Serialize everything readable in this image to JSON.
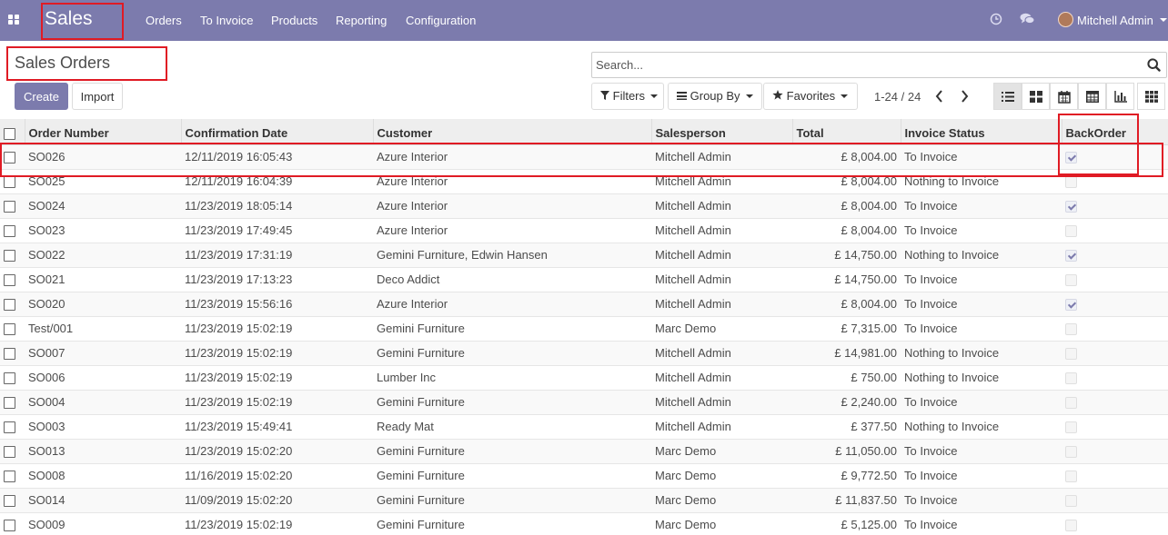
{
  "navbar": {
    "app_name": "Sales",
    "menu": [
      "Orders",
      "To Invoice",
      "Products",
      "Reporting",
      "Configuration"
    ],
    "user_name": "Mitchell Admin",
    "icons": [
      "apps-icon",
      "clock-icon",
      "chat-icon",
      "avatar"
    ]
  },
  "control_panel": {
    "title": "Sales Orders",
    "create_label": "Create",
    "import_label": "Import",
    "search_placeholder": "Search...",
    "filters_label": "Filters",
    "groupby_label": "Group By",
    "favorites_label": "Favorites",
    "pager": "1-24 / 24",
    "views": [
      "list",
      "kanban",
      "calendar",
      "pivot",
      "graph",
      "grid"
    ],
    "active_view": "list"
  },
  "table": {
    "columns": [
      "Order Number",
      "Confirmation Date",
      "Customer",
      "Salesperson",
      "Total",
      "Invoice Status",
      "BackOrder"
    ],
    "rows": [
      {
        "order": "SO026",
        "date": "12/11/2019 16:05:43",
        "customer": "Azure Interior",
        "salesperson": "Mitchell Admin",
        "total": "£ 8,004.00",
        "status": "To Invoice",
        "backorder": true
      },
      {
        "order": "SO025",
        "date": "12/11/2019 16:04:39",
        "customer": "Azure Interior",
        "salesperson": "Mitchell Admin",
        "total": "£ 8,004.00",
        "status": "Nothing to Invoice",
        "backorder": false
      },
      {
        "order": "SO024",
        "date": "11/23/2019 18:05:14",
        "customer": "Azure Interior",
        "salesperson": "Mitchell Admin",
        "total": "£ 8,004.00",
        "status": "To Invoice",
        "backorder": true
      },
      {
        "order": "SO023",
        "date": "11/23/2019 17:49:45",
        "customer": "Azure Interior",
        "salesperson": "Mitchell Admin",
        "total": "£ 8,004.00",
        "status": "To Invoice",
        "backorder": false
      },
      {
        "order": "SO022",
        "date": "11/23/2019 17:31:19",
        "customer": "Gemini Furniture, Edwin Hansen",
        "salesperson": "Mitchell Admin",
        "total": "£ 14,750.00",
        "status": "Nothing to Invoice",
        "backorder": true
      },
      {
        "order": "SO021",
        "date": "11/23/2019 17:13:23",
        "customer": "Deco Addict",
        "salesperson": "Mitchell Admin",
        "total": "£ 14,750.00",
        "status": "To Invoice",
        "backorder": false
      },
      {
        "order": "SO020",
        "date": "11/23/2019 15:56:16",
        "customer": "Azure Interior",
        "salesperson": "Mitchell Admin",
        "total": "£ 8,004.00",
        "status": "To Invoice",
        "backorder": true
      },
      {
        "order": "Test/001",
        "date": "11/23/2019 15:02:19",
        "customer": "Gemini Furniture",
        "salesperson": "Marc Demo",
        "total": "£ 7,315.00",
        "status": "To Invoice",
        "backorder": false
      },
      {
        "order": "SO007",
        "date": "11/23/2019 15:02:19",
        "customer": "Gemini Furniture",
        "salesperson": "Mitchell Admin",
        "total": "£ 14,981.00",
        "status": "Nothing to Invoice",
        "backorder": false
      },
      {
        "order": "SO006",
        "date": "11/23/2019 15:02:19",
        "customer": "Lumber Inc",
        "salesperson": "Mitchell Admin",
        "total": "£ 750.00",
        "status": "Nothing to Invoice",
        "backorder": false
      },
      {
        "order": "SO004",
        "date": "11/23/2019 15:02:19",
        "customer": "Gemini Furniture",
        "salesperson": "Mitchell Admin",
        "total": "£ 2,240.00",
        "status": "To Invoice",
        "backorder": false
      },
      {
        "order": "SO003",
        "date": "11/23/2019 15:49:41",
        "customer": "Ready Mat",
        "salesperson": "Mitchell Admin",
        "total": "£ 377.50",
        "status": "Nothing to Invoice",
        "backorder": false
      },
      {
        "order": "SO013",
        "date": "11/23/2019 15:02:20",
        "customer": "Gemini Furniture",
        "salesperson": "Marc Demo",
        "total": "£ 11,050.00",
        "status": "To Invoice",
        "backorder": false
      },
      {
        "order": "SO008",
        "date": "11/16/2019 15:02:20",
        "customer": "Gemini Furniture",
        "salesperson": "Marc Demo",
        "total": "£ 9,772.50",
        "status": "To Invoice",
        "backorder": false
      },
      {
        "order": "SO014",
        "date": "11/09/2019 15:02:20",
        "customer": "Gemini Furniture",
        "salesperson": "Marc Demo",
        "total": "£ 11,837.50",
        "status": "To Invoice",
        "backorder": false
      },
      {
        "order": "SO009",
        "date": "11/23/2019 15:02:19",
        "customer": "Gemini Furniture",
        "salesperson": "Marc Demo",
        "total": "£ 5,125.00",
        "status": "To Invoice",
        "backorder": false
      }
    ]
  },
  "colors": {
    "brand": "#7c7bad",
    "annotation": "#e01b24"
  }
}
